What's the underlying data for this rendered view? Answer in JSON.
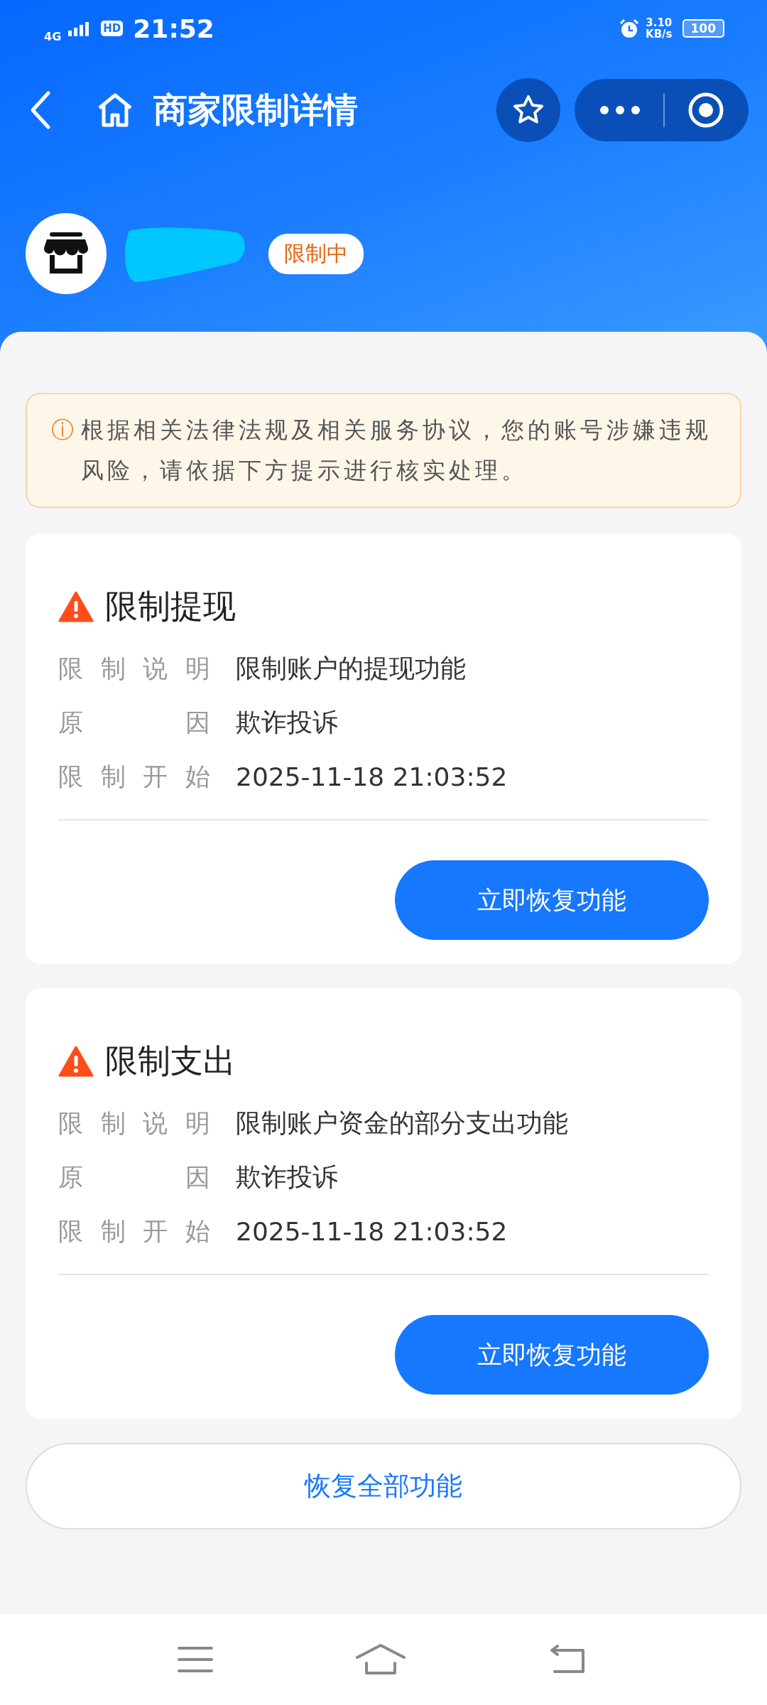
{
  "status_bar": {
    "network": "4G",
    "hd": "HD",
    "time": "21:52",
    "speed": "3.10",
    "speed_unit": "KB/s",
    "battery": "100"
  },
  "nav": {
    "title": "商家限制详情"
  },
  "merchant": {
    "badge": "限制中"
  },
  "notice": {
    "icon": "ⓘ",
    "text": "根据相关法律法规及相关服务协议，您的账号涉嫌违规风险，请依据下方提示进行核实处理。"
  },
  "restrictions": [
    {
      "title": "限制提现",
      "fields": [
        {
          "label": "限制说明",
          "value": "限制账户的提现功能"
        },
        {
          "label": "原因",
          "value": "欺诈投诉"
        },
        {
          "label": "限制开始",
          "value": "2025-11-18 21:03:52"
        }
      ],
      "button": "立即恢复功能"
    },
    {
      "title": "限制支出",
      "fields": [
        {
          "label": "限制说明",
          "value": "限制账户资金的部分支出功能"
        },
        {
          "label": "原因",
          "value": "欺诈投诉"
        },
        {
          "label": "限制开始",
          "value": "2025-11-18 21:03:52"
        }
      ],
      "button": "立即恢复功能"
    }
  ],
  "restore_all_button": "恢复全部功能"
}
